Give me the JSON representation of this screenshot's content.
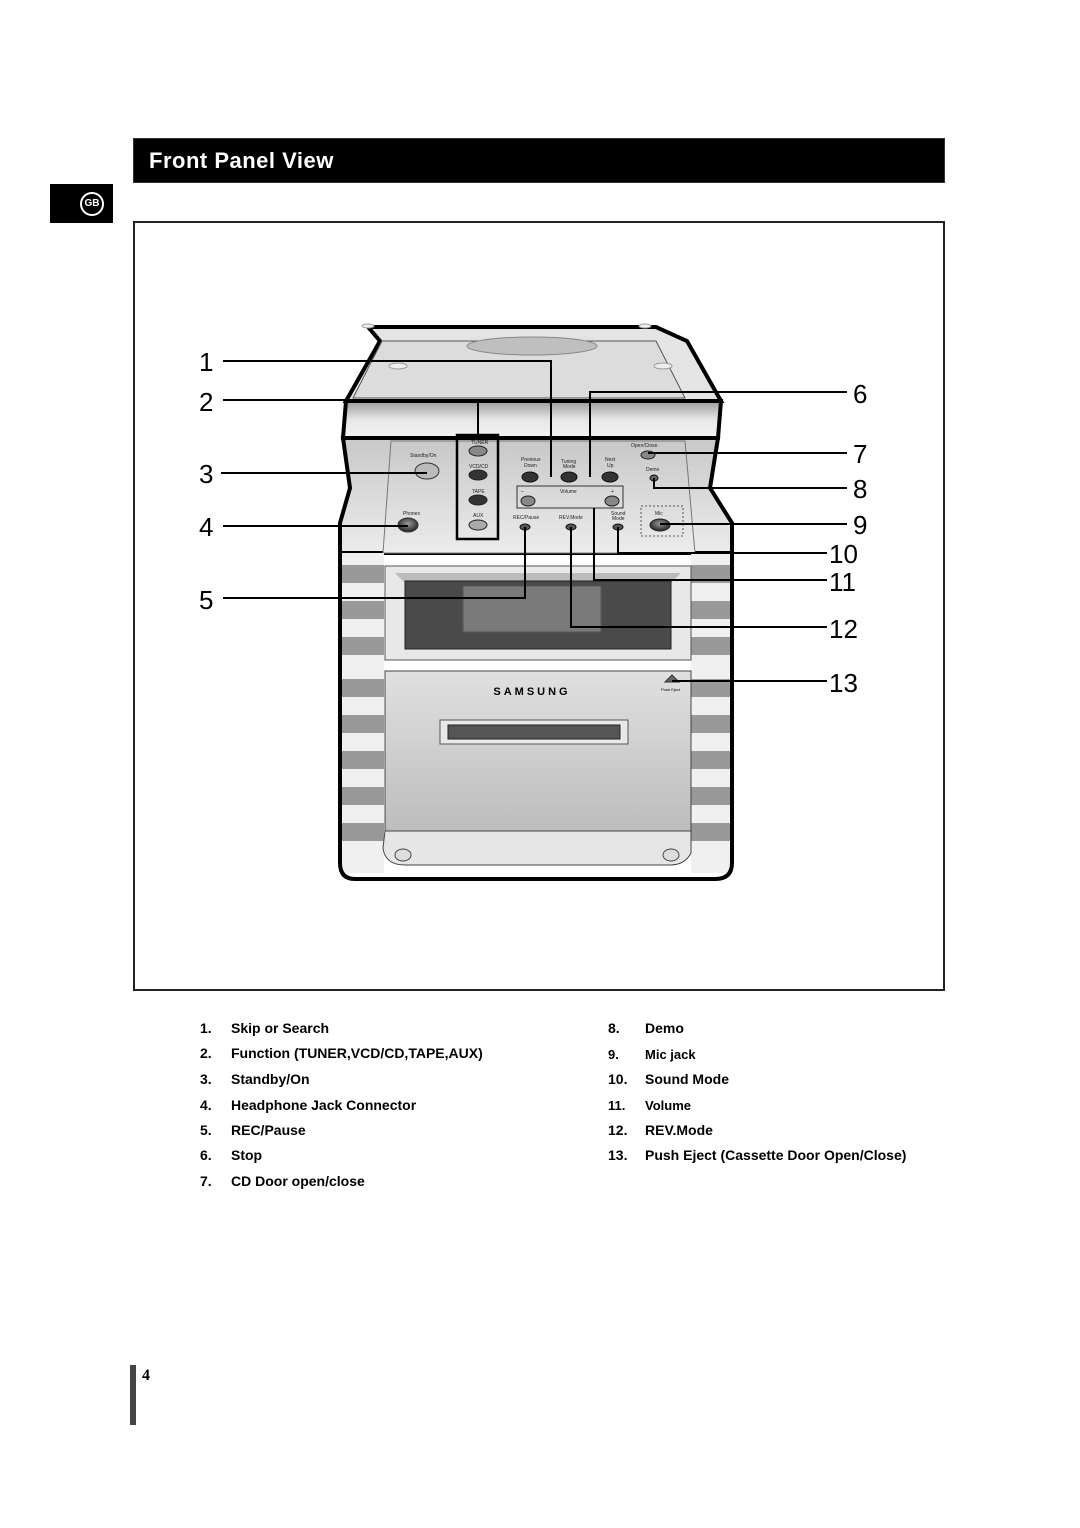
{
  "header": {
    "title": "Front Panel View",
    "language_badge": "GB"
  },
  "figure": {
    "device_labels": {
      "brand": "SAMSUNG",
      "standby": "Standby/On",
      "phones": "Phones",
      "tuner": "TUNER",
      "vcdcd": "VCD/CD",
      "tape": "TAPE",
      "aux": "AUX",
      "previous": "Previous",
      "down": "Down",
      "tuning": "Tuning",
      "mode": "Mode",
      "next": "Next",
      "up": "Up",
      "volume": "Volume",
      "minus": "–",
      "plus": "+",
      "rec_pause": "REC/Pause",
      "rev_mode": "REV.Mode",
      "sound": "Sound",
      "sound_mode": "Mode",
      "open_close": "Open/Close",
      "demo": "Demo",
      "mic": "Mic",
      "push_eject": "Push Eject"
    },
    "callouts_left": [
      "1",
      "2",
      "3",
      "4",
      "5"
    ],
    "callouts_right": [
      "6",
      "7",
      "8",
      "9",
      "10",
      "11",
      "12",
      "13"
    ]
  },
  "legend": {
    "left": [
      {
        "num": "1.",
        "text": "Skip or Search"
      },
      {
        "num": "2.",
        "text": "Function (TUNER,VCD/CD,TAPE,AUX)"
      },
      {
        "num": "3.",
        "text": "Standby/On"
      },
      {
        "num": "4.",
        "text": "Headphone Jack Connector"
      },
      {
        "num": "5.",
        "text": "REC/Pause"
      },
      {
        "num": "6.",
        "text": "Stop"
      },
      {
        "num": "7.",
        "text": "CD Door open/close"
      }
    ],
    "right": [
      {
        "num": "8.",
        "text": "Demo"
      },
      {
        "num": "9.",
        "text": "Mic jack"
      },
      {
        "num": "10.",
        "text": "Sound Mode"
      },
      {
        "num": "11.",
        "text": "Volume"
      },
      {
        "num": "12.",
        "text": "REV.Mode"
      },
      {
        "num": "13.",
        "text": "Push Eject (Cassette Door Open/Close)"
      }
    ]
  },
  "footer": {
    "page_number": "4"
  }
}
